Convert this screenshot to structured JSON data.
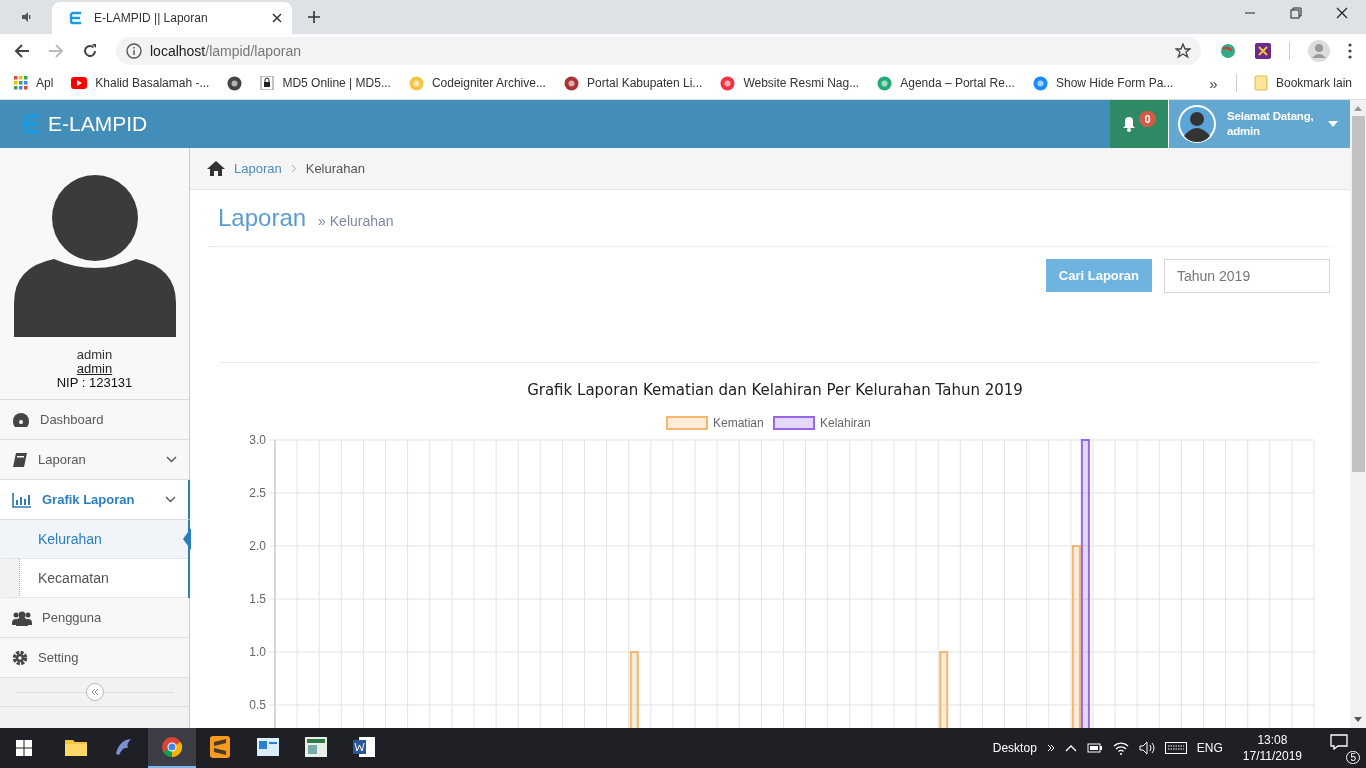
{
  "browser": {
    "tabs": [
      {
        "title": "E-LAMPID || Laporan",
        "selected": true
      }
    ],
    "address": {
      "host": "localhost",
      "path": "/lampid/laporan"
    },
    "bookmarks": [
      {
        "kind": "labeled",
        "label": "Apl"
      },
      {
        "kind": "labeled",
        "label": "Khalid Basalamah -..."
      },
      {
        "kind": "icon"
      },
      {
        "kind": "labeled",
        "label": "MD5 Online | MD5..."
      },
      {
        "kind": "labeled",
        "label": "Codeigniter Archive..."
      },
      {
        "kind": "labeled",
        "label": "Portal Kabupaten Li..."
      },
      {
        "kind": "labeled",
        "label": "Website Resmi Nag..."
      },
      {
        "kind": "labeled",
        "label": "Agenda – Portal Re..."
      },
      {
        "kind": "labeled",
        "label": "Show Hide Form Pa..."
      }
    ],
    "overflow": "»",
    "other_bookmarks": "Bookmark lain"
  },
  "header": {
    "logo": "E-LAMPID",
    "notifications": "0",
    "greeting": "Selamat Datang,",
    "user": "admin"
  },
  "profile": {
    "name": "admin",
    "username": "admin",
    "nip": "NIP : 123131"
  },
  "menu": [
    {
      "label": "Dashboard",
      "selected": false
    },
    {
      "label": "Laporan",
      "selected": false,
      "expanded": false
    },
    {
      "label": "Grafik Laporan",
      "selected": true,
      "expanded": true,
      "children": [
        {
          "label": "Kelurahan",
          "selected": true
        },
        {
          "label": "Kecamatan",
          "selected": false
        }
      ]
    },
    {
      "label": "Pengguna",
      "selected": false
    },
    {
      "label": "Setting",
      "selected": false
    }
  ],
  "breadcrumb": [
    "Laporan",
    "Kelurahan"
  ],
  "page": {
    "title": "Laporan",
    "subtitle": "» Kelurahan"
  },
  "search": {
    "button": "Cari Laporan",
    "value": "Tahun 2019"
  },
  "chart_data": {
    "type": "bar",
    "grid": true,
    "legend": true,
    "title": "Grafik Laporan Kematian dan Kelahiran Per Kelurahan Tahun 2019",
    "ylim": [
      0,
      3
    ],
    "yticks": [
      {
        "value": 0.5,
        "label": "0.5"
      },
      {
        "value": 1,
        "label": "1.0"
      },
      {
        "value": 1.5,
        "label": "1.5"
      },
      {
        "value": 2,
        "label": "2.0"
      },
      {
        "value": 2.5,
        "label": "2.5"
      },
      {
        "value": 3,
        "label": "3.0"
      }
    ],
    "series": [
      {
        "name": "Kematian",
        "color": "#f5b66e",
        "values": [
          0,
          0,
          0,
          0,
          0,
          0,
          0,
          0,
          0,
          0,
          0,
          0,
          0,
          0,
          0,
          0,
          1,
          0,
          0,
          0,
          0,
          0,
          0,
          0,
          0,
          0,
          0,
          0,
          0,
          0,
          1,
          0,
          0,
          0,
          0,
          0,
          2,
          0,
          0,
          0,
          0,
          0,
          0,
          0,
          0,
          0,
          0
        ]
      },
      {
        "name": "Kelahiran",
        "color": "#9966e8",
        "values": [
          0,
          0,
          0,
          0,
          0,
          0,
          0,
          0,
          0,
          0,
          0,
          0,
          0,
          0,
          0,
          0,
          0,
          0,
          0,
          0,
          0,
          0,
          0,
          0,
          0,
          0,
          0,
          0,
          0,
          0,
          0,
          0,
          0,
          0,
          0,
          0,
          3,
          0,
          0,
          0,
          0,
          0,
          0,
          0,
          0,
          0,
          0
        ]
      }
    ]
  },
  "taskbar": {
    "apps": [
      {
        "selected": false
      },
      {
        "selected": false
      },
      {
        "selected": true
      },
      {
        "selected": false
      },
      {
        "selected": false
      },
      {
        "selected": false
      },
      {
        "selected": false
      }
    ],
    "desktop": "Desktop",
    "language": "ENG",
    "time": "13:08",
    "date": "17/11/2019",
    "notifications": "5"
  }
}
